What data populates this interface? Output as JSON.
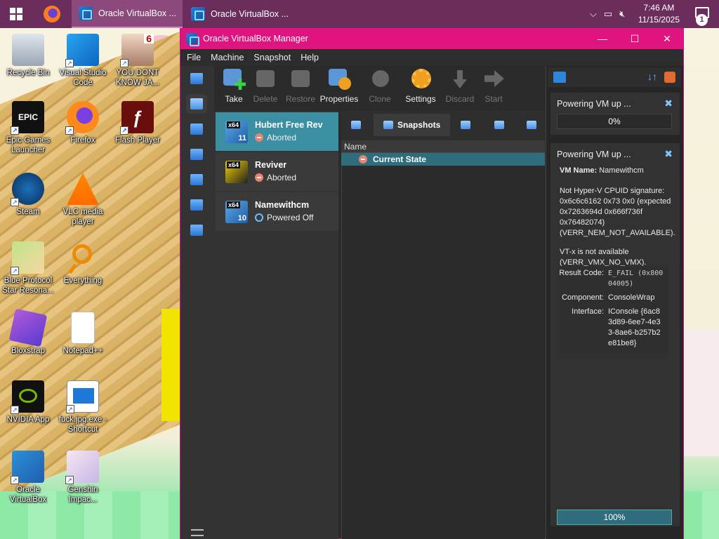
{
  "taskbar": {
    "apps": [
      {
        "label": "Oracle VirtualBox ...",
        "active": true
      },
      {
        "label": "Oracle VirtualBox ..."
      }
    ],
    "time": "7:46 AM",
    "date": "11/15/2025",
    "notification_count": "1"
  },
  "desktop": {
    "icons": [
      {
        "label": "Recycle Bin",
        "icon": "recycle-bin-icon"
      },
      {
        "label": "Visual Studio Code",
        "icon": "vscode-icon"
      },
      {
        "label": "YOU DONT KNOW JA...",
        "icon": "image-file-icon"
      },
      {
        "label": "Epic Games Launcher",
        "icon": "epic-games-icon"
      },
      {
        "label": "Firefox",
        "icon": "firefox-icon"
      },
      {
        "label": "Flash Player",
        "icon": "flash-player-icon"
      },
      {
        "label": "Steam",
        "icon": "steam-icon"
      },
      {
        "label": "VLC media player",
        "icon": "vlc-icon"
      },
      {
        "label": "Blue Protocol Star Resona...",
        "icon": "game-icon"
      },
      {
        "label": "Everything",
        "icon": "everything-search-icon"
      },
      {
        "label": "Bloxstrap",
        "icon": "bloxstrap-icon"
      },
      {
        "label": "Notepad++",
        "icon": "file-icon"
      },
      {
        "label": "NVIDIA App",
        "icon": "nvidia-icon"
      },
      {
        "label": "fuck.jpg.exe - Shortcut",
        "icon": "shortcut-icon"
      },
      {
        "label": "Oracle VirtualBox",
        "icon": "virtualbox-icon"
      },
      {
        "label": "Genshin Impac...",
        "icon": "genshin-icon"
      }
    ]
  },
  "window": {
    "title": "Oracle VirtualBox Manager",
    "menu": [
      "File",
      "Machine",
      "Snapshot",
      "Help"
    ],
    "toolbar": [
      "Take",
      "Delete",
      "Restore",
      "Properties",
      "Clone",
      "Settings",
      "Discard",
      "Start"
    ],
    "vms": [
      {
        "name": "Hubert Free Rev",
        "state": "Aborted",
        "os_tag": "x64",
        "os_ver": "11"
      },
      {
        "name": "Reviver",
        "state": "Aborted",
        "os_tag": "x64",
        "os_ver": ""
      },
      {
        "name": "Namewithcm",
        "state": "Powered Off",
        "os_tag": "x64",
        "os_ver": "10"
      }
    ],
    "tabs": {
      "snapshots": "Snapshots"
    },
    "snapshots": {
      "column": "Name",
      "current": "Current State"
    }
  },
  "notifications": {
    "task1": {
      "title": "Powering VM up ...",
      "progress": "0%"
    },
    "task2": {
      "title": "Powering VM up ...",
      "vm_label": "VM Name:",
      "vm_name": "Namewithcm",
      "msg1": "Not Hyper-V CPUID signature: 0x6c6c6162 0x73 0x0 (expected 0x7263694d 0x666f736f 0x76482074) (VERR_NEM_NOT_AVAILABLE).",
      "msg2": "VT-x is not available (VERR_VMX_NO_VMX).",
      "result_code_label": "Result Code:",
      "result_code": "E_FAIL (0x80004005)",
      "component_label": "Component:",
      "component": "ConsoleWrap",
      "interface_label": "Interface:",
      "interface": "IConsole {6ac83d89-6ee7-4e33-8ae6-b257b2e81be8}",
      "progress": "100%"
    }
  },
  "colors": {
    "accent": "#e0147f",
    "selection": "#3b8fa3",
    "taskbar": "#6a2d5c"
  }
}
